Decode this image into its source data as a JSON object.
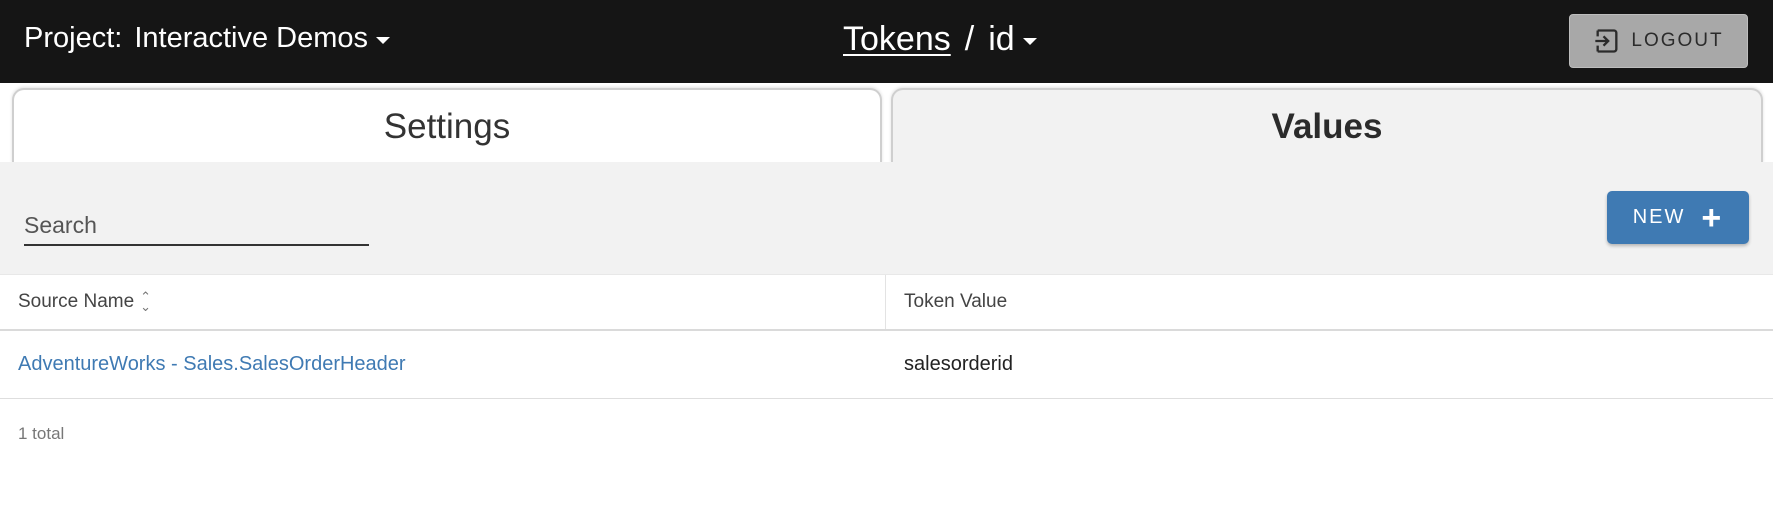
{
  "header": {
    "project_label": "Project:",
    "project_name": "Interactive Demos",
    "breadcrumb_parent": "Tokens",
    "breadcrumb_separator": "/",
    "breadcrumb_current": "id",
    "logout_label": "LOGOUT"
  },
  "tabs": [
    {
      "label": "Settings",
      "active": false
    },
    {
      "label": "Values",
      "active": true
    }
  ],
  "toolbar": {
    "search_placeholder": "Search",
    "search_value": "",
    "new_label": "NEW"
  },
  "table": {
    "columns": [
      "Source Name",
      "Token Value"
    ],
    "rows": [
      {
        "source_name": "AdventureWorks - Sales.SalesOrderHeader",
        "token_value": "salesorderid"
      }
    ],
    "total_text": "1 total"
  },
  "colors": {
    "topbar": "#151515",
    "accent": "#3f7ab3",
    "panel": "#f2f2f2"
  },
  "icons": {
    "logout": "logout-icon",
    "new": "plus-icon",
    "sort": "sort-icon",
    "dropdown": "caret-down-icon"
  }
}
